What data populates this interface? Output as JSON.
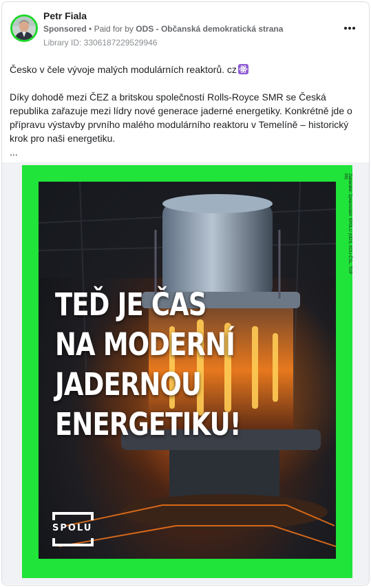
{
  "post": {
    "author": "Petr Fiala",
    "sponsored_label": "Sponsored",
    "paid_for_prefix": "Paid for by",
    "paid_for_by": "ODS - Občanská demokratická strana",
    "library_id": "Library ID: 3306187229529946",
    "more_options_icon": "more-horizontal-icon"
  },
  "content": {
    "line1": "Česko v čele vývoje malých modulárních reaktorů. cz",
    "line1_emoji": "atom-symbol",
    "paragraph": "Díky dohodě mezi ČEZ a britskou společností Rolls-Royce SMR se Česká republika zařazuje mezi lídry nové generace jaderné energetiky. Konkrétně jde o přípravu výstavby prvního malého modulárního reaktoru v Temelíně – historický krok pro naši energetiku.",
    "ellipsis": "..."
  },
  "ad_image": {
    "headline_lines": [
      "TEĎ JE ČAS",
      "NA MODERNÍ",
      "JADERNOU",
      "ENERGETIKU!"
    ],
    "disclaimer": "Zadavatel: Zpracovatel: SPOLU (ODS, KDU-ČSL, TOP 09)",
    "logo_text": "SPOLU",
    "frame_color": "#20e43a"
  }
}
